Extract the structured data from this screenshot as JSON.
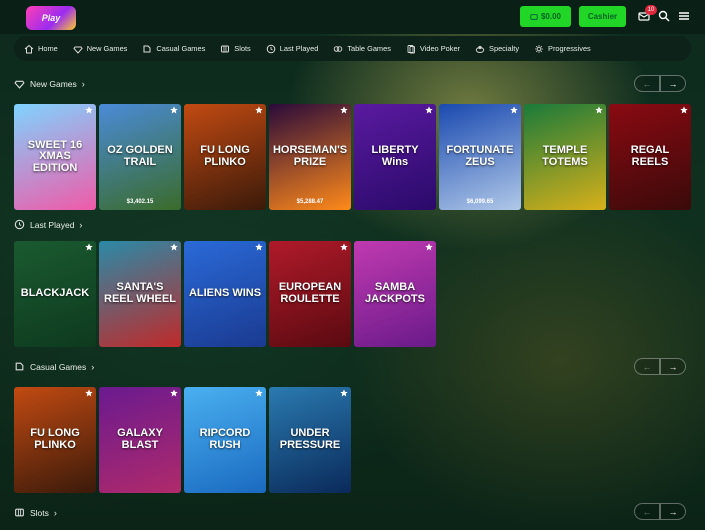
{
  "header": {
    "logo_text": "Play",
    "balance": "$0.00",
    "cashier": "Cashier",
    "notification_count": "10"
  },
  "nav": [
    {
      "label": "Home",
      "icon": "home-icon"
    },
    {
      "label": "New Games",
      "icon": "diamond-icon"
    },
    {
      "label": "Casual Games",
      "icon": "casual-icon"
    },
    {
      "label": "Slots",
      "icon": "slots-icon"
    },
    {
      "label": "Last Played",
      "icon": "clock-icon"
    },
    {
      "label": "Table Games",
      "icon": "chips-icon"
    },
    {
      "label": "Video Poker",
      "icon": "poker-icon"
    },
    {
      "label": "Specialty",
      "icon": "specialty-icon"
    },
    {
      "label": "Progressives",
      "icon": "progressive-icon"
    }
  ],
  "sections": {
    "new_games": {
      "title": "New Games",
      "tiles": [
        {
          "title": "SWEET 16 XMAS EDITION",
          "amount": "",
          "bg1": "#7fd3ff",
          "bg2": "#f05aa8"
        },
        {
          "title": "OZ GOLDEN TRAIL",
          "amount": "$3,402.15",
          "bg1": "#4a8bd8",
          "bg2": "#3a6b2a"
        },
        {
          "title": "FU LONG PLINKO",
          "amount": "",
          "bg1": "#c24a12",
          "bg2": "#3a1a0a"
        },
        {
          "title": "HORSEMAN'S PRIZE",
          "amount": "$5,288.47",
          "bg1": "#2a0a3a",
          "bg2": "#ff8a1a"
        },
        {
          "title": "LIBERTY Wins",
          "amount": "",
          "bg1": "#5a1aa0",
          "bg2": "#2a0a6a"
        },
        {
          "title": "FORTUNATE ZEUS",
          "amount": "$6,099.65",
          "bg1": "#1a4ab0",
          "bg2": "#b0c8e8"
        },
        {
          "title": "TEMPLE TOTEMS",
          "amount": "",
          "bg1": "#1a7a3a",
          "bg2": "#d8b01a"
        },
        {
          "title": "REGAL REELS",
          "amount": "",
          "bg1": "#8a0a12",
          "bg2": "#3a0a0a"
        }
      ]
    },
    "last_played": {
      "title": "Last Played",
      "tiles": [
        {
          "title": "BLACKJACK",
          "amount": "",
          "bg1": "#1a5a30",
          "bg2": "#0e3a1e"
        },
        {
          "title": "SANTA'S REEL WHEEL",
          "amount": "",
          "bg1": "#2a8aa8",
          "bg2": "#c02a2a"
        },
        {
          "title": "ALIENS WINS",
          "amount": "",
          "bg1": "#2a6ad8",
          "bg2": "#1a3a90"
        },
        {
          "title": "EUROPEAN ROULETTE",
          "amount": "",
          "bg1": "#b01a2a",
          "bg2": "#5a0a10"
        },
        {
          "title": "SAMBA JACKPOTS",
          "amount": "",
          "bg1": "#c03ab0",
          "bg2": "#6a1a8a"
        }
      ]
    },
    "casual_games": {
      "title": "Casual Games",
      "tiles": [
        {
          "title": "FU LONG PLINKO",
          "amount": "",
          "bg1": "#c24a12",
          "bg2": "#3a1a0a"
        },
        {
          "title": "GALAXY BLAST",
          "amount": "",
          "bg1": "#6a1a90",
          "bg2": "#b02a6a"
        },
        {
          "title": "RIPCORD RUSH",
          "amount": "",
          "bg1": "#4ab0f0",
          "bg2": "#1a6ac0"
        },
        {
          "title": "UNDER PRESSURE",
          "amount": "",
          "bg1": "#2a7ab0",
          "bg2": "#0a2a5a"
        }
      ]
    },
    "slots": {
      "title": "Slots"
    }
  }
}
